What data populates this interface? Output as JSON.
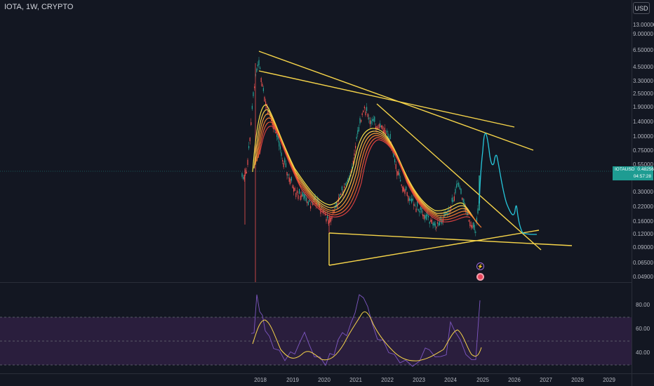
{
  "header": {
    "symbol_legend": "IOTA, 1W, CRYPTO"
  },
  "price_scale": {
    "currency_button": "USD",
    "labels": [
      "13.00000",
      "9.00000",
      "6.50000",
      "4.50000",
      "3.30000",
      "2.50000",
      "1.90000",
      "1.40000",
      "1.00000",
      "0.75000",
      "0.55000",
      "0.30000",
      "0.22000",
      "0.16000",
      "0.12000",
      "0.09000",
      "0.06500",
      "0.04900"
    ]
  },
  "last_price": {
    "ticker": "IOTAUSD",
    "price": "0.48256",
    "countdown": "04:57:28"
  },
  "rsi_scale": {
    "labels": [
      "80.00",
      "60.00",
      "40.00"
    ]
  },
  "time_axis": {
    "labels": [
      "2018",
      "2019",
      "2020",
      "2021",
      "2022",
      "2023",
      "2024",
      "2025",
      "2026",
      "2027",
      "2028",
      "2029"
    ]
  },
  "colors": {
    "background": "#131722",
    "trendlines": "#f7d54a",
    "projection": "#26c6da",
    "rsi_line": "#7e57c2",
    "rsi_ma": "#f7d54a",
    "rsi_band": "#2a1e3d",
    "last_price_tag": "#1e9c92"
  },
  "markers": {
    "event_icon": "lightning-icon",
    "earnings_icon": "earnings-icon"
  }
}
